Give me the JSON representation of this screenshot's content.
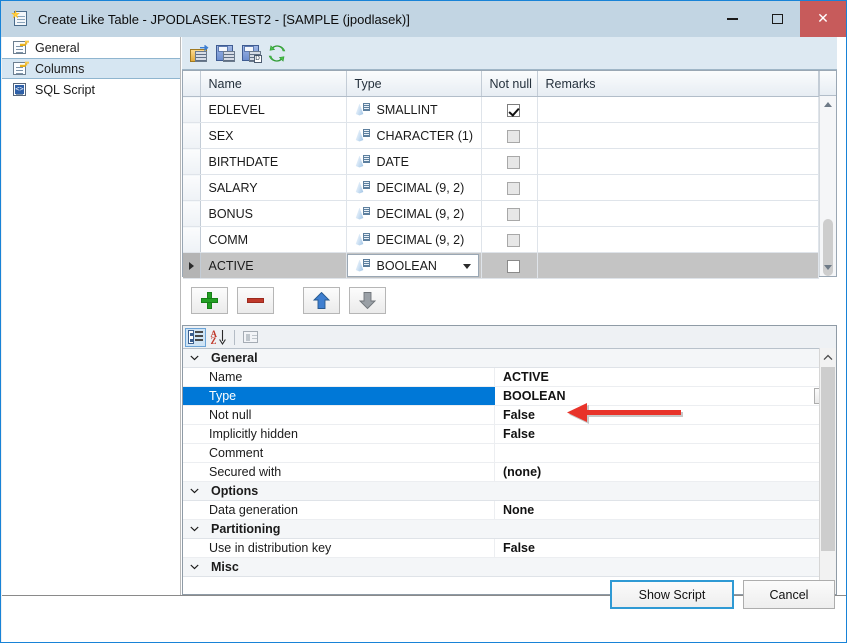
{
  "window": {
    "title": "Create Like Table - JPODLASEK.TEST2 - [SAMPLE (jpodlasek)]",
    "icon": "table-wizard-icon",
    "controls": {
      "minimize": "–",
      "maximize": "☐",
      "close": "✕"
    }
  },
  "sidebar": {
    "items": [
      {
        "label": "General",
        "icon": "page-key-icon",
        "selected": false
      },
      {
        "label": "Columns",
        "icon": "page-key-icon",
        "selected": true
      },
      {
        "label": "SQL Script",
        "icon": "sql-script-icon",
        "selected": false
      }
    ]
  },
  "toolbar": {
    "buttons": [
      {
        "name": "open-folder-button",
        "icon": "folder-open-icon",
        "tooltip": "Load"
      },
      {
        "name": "save-button",
        "icon": "floppy-save-icon",
        "tooltip": "Save"
      },
      {
        "name": "save-as-button",
        "icon": "floppy-save-as-icon",
        "tooltip": "Save As"
      },
      {
        "name": "refresh-button",
        "icon": "refresh-icon",
        "tooltip": "Refresh"
      }
    ]
  },
  "columns_grid": {
    "headers": [
      "",
      "Name",
      "Type",
      "Not null",
      "Remarks"
    ],
    "rows": [
      {
        "name": "EDLEVEL",
        "type": "SMALLINT",
        "not_null": true,
        "remarks": "",
        "selected": false,
        "editing": false
      },
      {
        "name": "SEX",
        "type": "CHARACTER (1)",
        "not_null": false,
        "remarks": "",
        "selected": false,
        "editing": false
      },
      {
        "name": "BIRTHDATE",
        "type": "DATE",
        "not_null": false,
        "remarks": "",
        "selected": false,
        "editing": false
      },
      {
        "name": "SALARY",
        "type": "DECIMAL (9, 2)",
        "not_null": false,
        "remarks": "",
        "selected": false,
        "editing": false
      },
      {
        "name": "BONUS",
        "type": "DECIMAL (9, 2)",
        "not_null": false,
        "remarks": "",
        "selected": false,
        "editing": false
      },
      {
        "name": "COMM",
        "type": "DECIMAL (9, 2)",
        "not_null": false,
        "remarks": "",
        "selected": false,
        "editing": false
      },
      {
        "name": "ACTIVE",
        "type": "BOOLEAN",
        "not_null": false,
        "remarks": "",
        "selected": true,
        "editing": true
      }
    ]
  },
  "row_actions": [
    {
      "name": "add-column-button",
      "icon": "plus-icon",
      "label": "+"
    },
    {
      "name": "remove-column-button",
      "icon": "minus-icon",
      "label": "–"
    },
    {
      "name": "move-up-button",
      "icon": "arrow-up-icon",
      "label": "↑"
    },
    {
      "name": "move-down-button",
      "icon": "arrow-down-icon",
      "label": "↓"
    }
  ],
  "property_grid": {
    "toolbar": [
      {
        "name": "categorized-view-button",
        "icon": "categorized-icon",
        "pressed": true
      },
      {
        "name": "alphabetical-sort-button",
        "icon": "sort-az-icon",
        "pressed": false
      },
      {
        "name": "property-pages-button",
        "icon": "property-pages-icon",
        "pressed": false
      }
    ],
    "categories": [
      {
        "label": "General",
        "expanded": true,
        "rows": [
          {
            "label": "Name",
            "value": "ACTIVE",
            "selected": false,
            "dropdown": false
          },
          {
            "label": "Type",
            "value": "BOOLEAN",
            "selected": true,
            "dropdown": true
          },
          {
            "label": "Not null",
            "value": "False",
            "selected": false,
            "dropdown": false
          },
          {
            "label": "Implicitly hidden",
            "value": "False",
            "selected": false,
            "dropdown": false
          },
          {
            "label": "Comment",
            "value": "",
            "selected": false,
            "dropdown": false
          },
          {
            "label": "Secured with",
            "value": "(none)",
            "selected": false,
            "dropdown": false
          }
        ]
      },
      {
        "label": "Options",
        "expanded": true,
        "rows": [
          {
            "label": "Data generation",
            "value": "None",
            "selected": false,
            "dropdown": false
          }
        ]
      },
      {
        "label": "Partitioning",
        "expanded": true,
        "rows": [
          {
            "label": "Use in distribution key",
            "value": "False",
            "selected": false,
            "dropdown": false
          }
        ]
      },
      {
        "label": "Misc",
        "expanded": true,
        "rows": []
      }
    ]
  },
  "footer": {
    "show_script_label": "Show Script",
    "cancel_label": "Cancel"
  },
  "annotation": {
    "arrow_color": "#e8332a",
    "points_to": "BOOLEAN"
  },
  "colors": {
    "titlebar": "#c2d5e3",
    "close_button": "#c75b5b",
    "selection_blue": "#0078d7",
    "nav_selected": "#d6e6f2",
    "active_row_gray": "#c4c4c4",
    "primary_button_border": "#2f9ad4"
  }
}
